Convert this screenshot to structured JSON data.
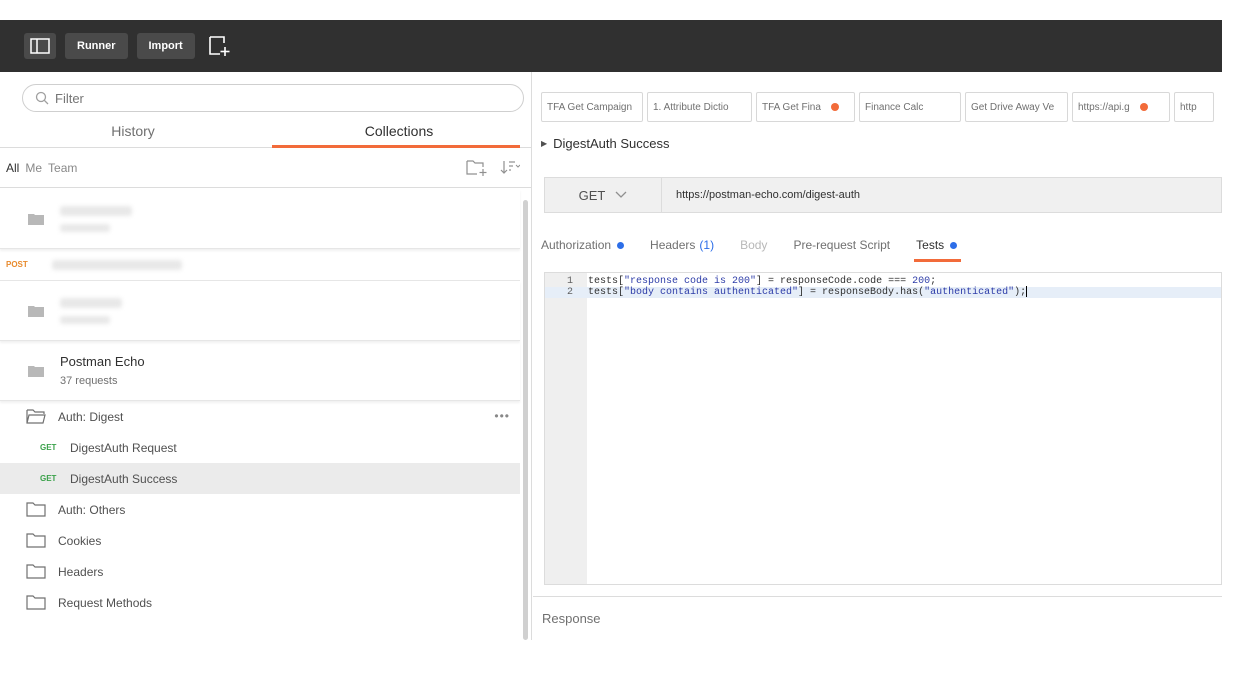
{
  "topbar": {
    "runner_label": "Runner",
    "import_label": "Import"
  },
  "sidebar": {
    "filter_placeholder": "Filter",
    "tabs": [
      {
        "label": "History"
      },
      {
        "label": "Collections"
      }
    ],
    "filters": {
      "all": "All",
      "me": "Me",
      "team": "Team"
    },
    "post_badge": "POST",
    "collection": {
      "name": "Postman Echo",
      "count": "37 requests"
    },
    "tree": [
      {
        "type": "folder-open",
        "label": "Auth: Digest"
      },
      {
        "type": "request",
        "method": "GET",
        "label": "DigestAuth Request"
      },
      {
        "type": "request",
        "method": "GET",
        "label": "DigestAuth Success"
      },
      {
        "type": "folder",
        "label": "Auth: Others"
      },
      {
        "type": "folder",
        "label": "Cookies"
      },
      {
        "type": "folder",
        "label": "Headers"
      },
      {
        "type": "folder",
        "label": "Request Methods"
      }
    ]
  },
  "main": {
    "request_tabs": [
      {
        "label": "TFA Get Campaign"
      },
      {
        "label": "1. Attribute Dictio"
      },
      {
        "label": "TFA Get Fina"
      },
      {
        "label": "Finance Calc"
      },
      {
        "label": "Get Drive Away Ve"
      },
      {
        "label": "https://api.g"
      },
      {
        "label": "http"
      }
    ],
    "breadcrumb": "DigestAuth Success",
    "method": "GET",
    "url": "https://postman-echo.com/digest-auth",
    "sub_tabs": {
      "authorization": "Authorization",
      "headers": "Headers",
      "headers_count": "(1)",
      "body": "Body",
      "prerequest": "Pre-request Script",
      "tests": "Tests"
    },
    "code_lines": [
      {
        "num": "1",
        "pre": "tests[",
        "s1": "\"response code is 200\"",
        "mid": "] = responseCode.code === ",
        "s2": "200",
        "post": ";"
      },
      {
        "num": "2",
        "pre": "tests[",
        "s1": "\"body contains authenticated\"",
        "mid": "] = responseBody.has(",
        "s2": "\"authenticated\"",
        "post": ");"
      }
    ],
    "response_label": "Response"
  },
  "colors": {
    "accent": "#f26b3a",
    "get": "#3aa14a",
    "post": "#e88a2c",
    "dot_blue": "#2d6ee8"
  }
}
